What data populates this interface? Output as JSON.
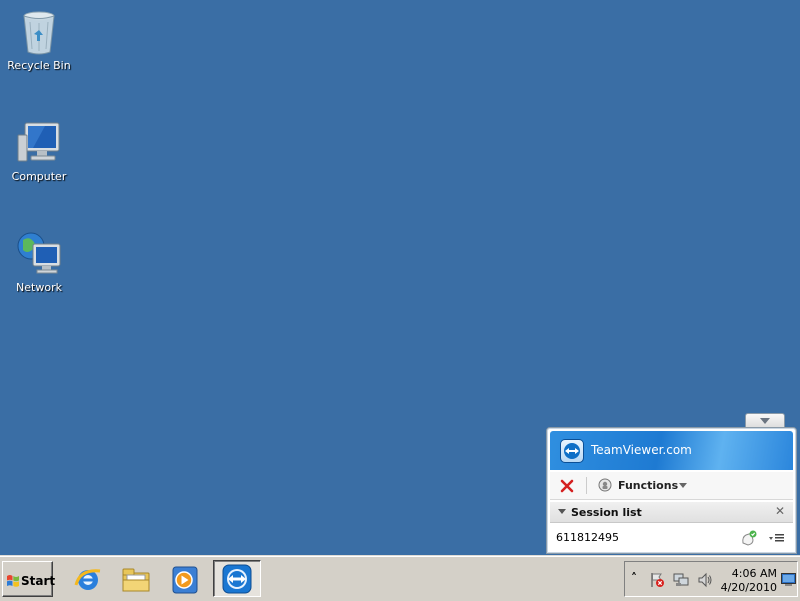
{
  "desktop": {
    "icons": [
      {
        "label": "Recycle Bin",
        "icon": "recycle-bin-icon"
      },
      {
        "label": "Computer",
        "icon": "computer-icon"
      },
      {
        "label": "Network",
        "icon": "network-icon"
      }
    ]
  },
  "teamviewer": {
    "brand": "TeamViewer.com",
    "functions_label": "Functions",
    "session_list_title": "Session list",
    "session_id": "611812495",
    "close_symbol": "✕"
  },
  "taskbar": {
    "start_label": "Start",
    "quick_launch": [
      {
        "icon": "internet-explorer-icon"
      },
      {
        "icon": "file-explorer-icon"
      },
      {
        "icon": "media-player-icon"
      }
    ],
    "active_task": {
      "icon": "teamviewer-icon"
    },
    "tray": {
      "expand_symbol": "˄",
      "clock_time": "4:06 AM",
      "clock_date": "4/20/2010"
    }
  },
  "colors": {
    "desktop_bg": "#3a6ea5",
    "teamviewer_blue": "#1e7ad2",
    "taskbar_bg": "#d4d0c8"
  }
}
